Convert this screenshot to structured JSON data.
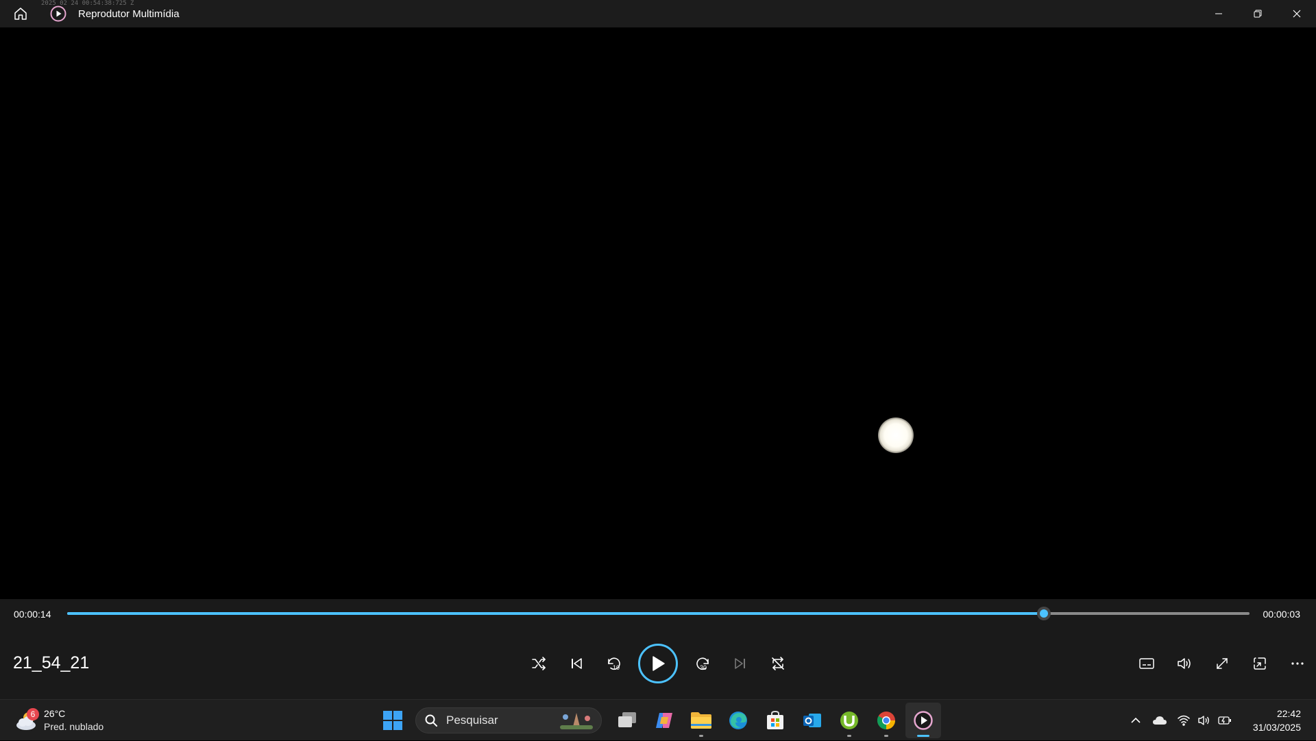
{
  "window": {
    "title": "Reprodutor Multimídia",
    "watermark": "2025 02 24 00:54:38:725 Z"
  },
  "player": {
    "elapsed": "00:00:14",
    "remaining": "00:00:03",
    "progress_fraction": 0.826,
    "media_title": "21_54_21",
    "accent_color": "#4cc2ff",
    "center_controls": [
      "shuffle-icon",
      "previous-icon",
      "rewind-10-icon",
      "play-icon",
      "forward-30-icon",
      "next-icon",
      "repeat-icon"
    ],
    "right_controls": [
      "subtitles-icon",
      "volume-icon",
      "fullscreen-icon",
      "miniplayer-icon",
      "more-icon"
    ]
  },
  "taskbar": {
    "weather": {
      "badge": "6",
      "temperature": "26°C",
      "condition": "Pred. nublado"
    },
    "search_placeholder": "Pesquisar",
    "apps": [
      "start",
      "search",
      "task-view",
      "copilot",
      "file-explorer",
      "edge",
      "microsoft-store",
      "outlook",
      "utorrent",
      "chrome",
      "media-player"
    ],
    "time": "22:42",
    "date": "31/03/2025"
  }
}
